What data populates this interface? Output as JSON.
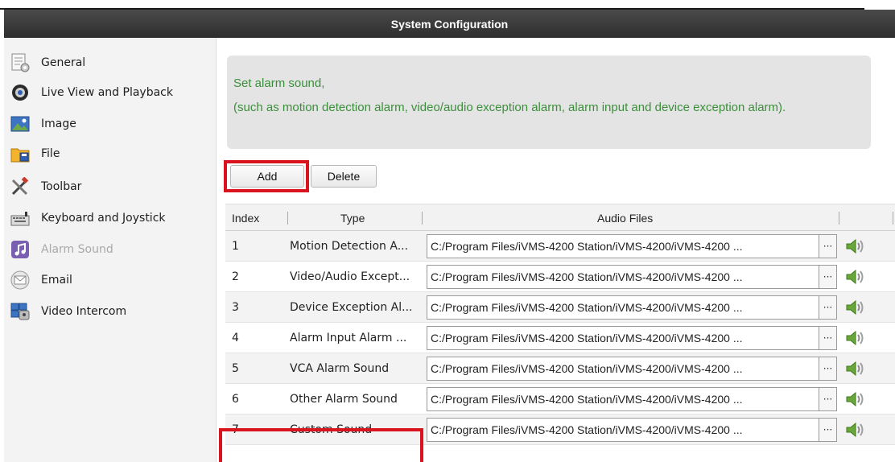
{
  "window": {
    "title": "System Configuration"
  },
  "sidebar": {
    "items": [
      {
        "label": "General",
        "icon": "general-settings-icon",
        "state": "normal"
      },
      {
        "label": "Live View and Playback",
        "icon": "camera-lens-icon",
        "state": "normal"
      },
      {
        "label": "Image",
        "icon": "image-icon",
        "state": "normal"
      },
      {
        "label": "File",
        "icon": "folder-icon",
        "state": "normal"
      },
      {
        "label": "Toolbar",
        "icon": "tools-icon",
        "state": "normal"
      },
      {
        "label": "Keyboard and Joystick",
        "icon": "keyboard-icon",
        "state": "normal"
      },
      {
        "label": "Alarm Sound",
        "icon": "music-note-icon",
        "state": "selected"
      },
      {
        "label": "Email",
        "icon": "envelope-icon",
        "state": "normal"
      },
      {
        "label": "Video Intercom",
        "icon": "video-intercom-icon",
        "state": "normal"
      }
    ]
  },
  "notice": {
    "line1": "Set alarm sound,",
    "line2": "(such as motion detection alarm, video/audio exception alarm, alarm input and device exception alarm)."
  },
  "toolbar": {
    "add_label": "Add",
    "delete_label": "Delete"
  },
  "table": {
    "headers": {
      "index": "Index",
      "type": "Type",
      "audio_files": "Audio Files"
    },
    "rows": [
      {
        "index": "1",
        "type": "Motion Detection A...",
        "file": "C:/Program Files/iVMS-4200 Station/iVMS-4200/iVMS-4200 ...",
        "browse": "···"
      },
      {
        "index": "2",
        "type": "Video/Audio Except...",
        "file": "C:/Program Files/iVMS-4200 Station/iVMS-4200/iVMS-4200 ...",
        "browse": "···"
      },
      {
        "index": "3",
        "type": "Device Exception Al...",
        "file": "C:/Program Files/iVMS-4200 Station/iVMS-4200/iVMS-4200 ...",
        "browse": "···"
      },
      {
        "index": "4",
        "type": "Alarm Input Alarm ...",
        "file": "C:/Program Files/iVMS-4200 Station/iVMS-4200/iVMS-4200 ...",
        "browse": "···"
      },
      {
        "index": "5",
        "type": "VCA Alarm Sound",
        "file": "C:/Program Files/iVMS-4200 Station/iVMS-4200/iVMS-4200 ...",
        "browse": "···"
      },
      {
        "index": "6",
        "type": "Other Alarm Sound",
        "file": "C:/Program Files/iVMS-4200 Station/iVMS-4200/iVMS-4200 ...",
        "browse": "···"
      },
      {
        "index": "7",
        "type": "Custom Sound",
        "file": "C:/Program Files/iVMS-4200 Station/iVMS-4200/iVMS-4200 ...",
        "browse": "···"
      }
    ]
  },
  "colors": {
    "title_bar": "#3a3a3a",
    "notice_text": "#3b8f3b",
    "highlight_box": "#d9141e",
    "disabled_text": "#a9a9a9"
  }
}
